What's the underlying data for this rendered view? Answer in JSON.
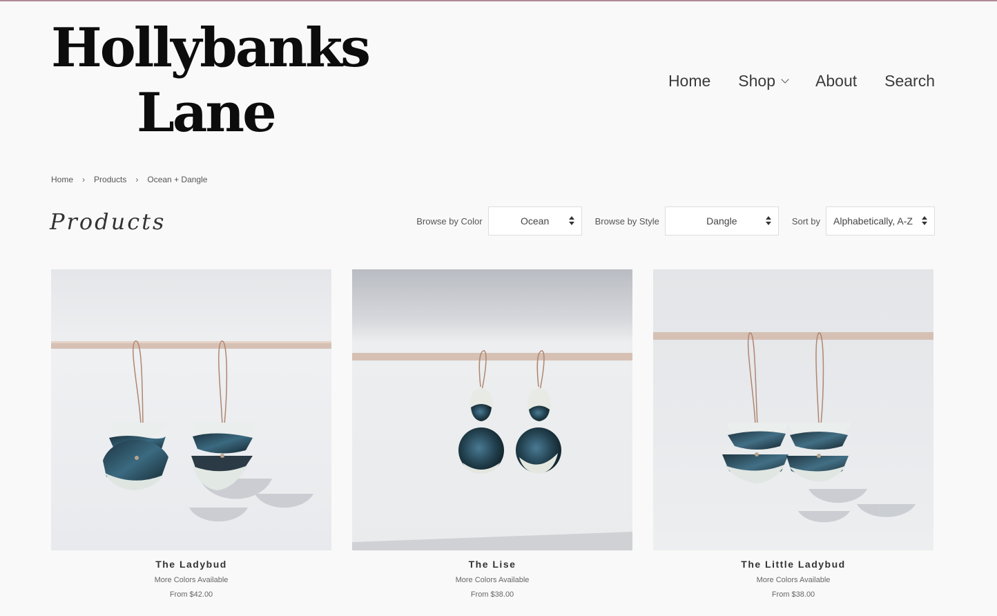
{
  "logo": {
    "line1": "Hollybanks",
    "line2": "Lane"
  },
  "nav": {
    "home": "Home",
    "shop": "Shop",
    "about": "About",
    "search": "Search"
  },
  "breadcrumb": {
    "home": "Home",
    "products": "Products",
    "current": "Ocean + Dangle",
    "separator": "›"
  },
  "page": {
    "title": "Products"
  },
  "filters": {
    "color_label": "Browse by Color",
    "color_value": "Ocean",
    "style_label": "Browse by Style",
    "style_value": "Dangle",
    "sort_label": "Sort by",
    "sort_value": "Alphabetically, A-Z"
  },
  "products": [
    {
      "name": "The Ladybud",
      "note": "More Colors Available",
      "price": "From $42.00"
    },
    {
      "name": "The Lise",
      "note": "More Colors Available",
      "price": "From $38.00"
    },
    {
      "name": "The Little Ladybud",
      "note": "More Colors Available",
      "price": "From $38.00"
    }
  ],
  "colors": {
    "accent_line": "#b08a96",
    "background": "#f9f9f9",
    "glaze": "#2c4a55"
  }
}
